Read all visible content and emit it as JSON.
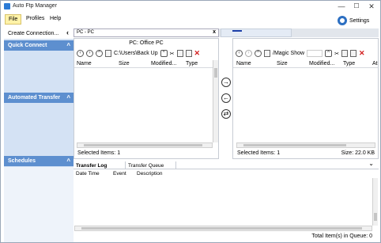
{
  "window": {
    "title": "Auto Ftp Manager",
    "minimize": "—",
    "maximize": "☐",
    "close": "✕"
  },
  "menu": {
    "items": [
      "File",
      "Profiles",
      "Help"
    ],
    "settings_label": "Settings"
  },
  "sidebar": {
    "create_connection": "Create Connection...",
    "collapse": "‹",
    "sections": [
      "Quick Connect",
      "Automated Transfer",
      "Schedules"
    ],
    "chevron": "^"
  },
  "tabs": {
    "active_label": "PC - PC",
    "close": "x"
  },
  "left_pane": {
    "title": "PC: Office PC",
    "path": "C:\\Users\\Back Up",
    "columns": [
      "Name",
      "Size",
      "Modified...",
      "Type"
    ],
    "selected": "Selected Items: 1"
  },
  "right_pane": {
    "path": "/Magic Show",
    "columns": [
      "Name",
      "Size",
      "Modified...",
      "Type",
      "At"
    ],
    "selected": "Selected Items: 1",
    "size": "Size: 22.0 KB"
  },
  "transfer_buttons": [
    "→",
    "←",
    "⇄"
  ],
  "log": {
    "tabs": [
      "Transfer Log",
      "Transfer Queue"
    ],
    "columns": [
      "Date Time",
      "Event",
      "Description"
    ],
    "collapse": "⌄"
  },
  "status": {
    "queue": "Total Item(s) in Queue: 0"
  }
}
